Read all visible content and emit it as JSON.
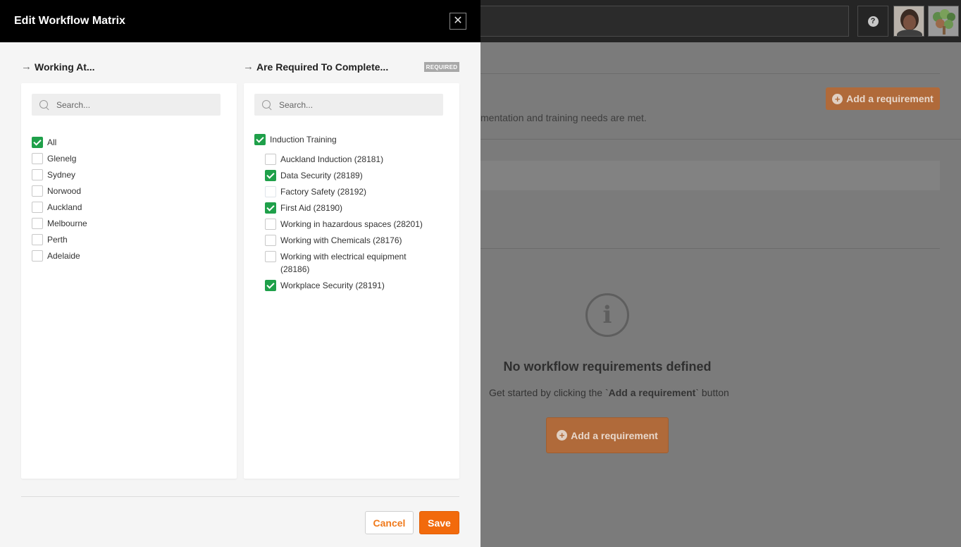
{
  "modal": {
    "title": "Edit Workflow Matrix",
    "close_symbol": "✕"
  },
  "working_at": {
    "heading": "Working At...",
    "search_placeholder": "Search...",
    "items": [
      {
        "label": "All",
        "checked": true
      },
      {
        "label": "Glenelg",
        "checked": false
      },
      {
        "label": "Sydney",
        "checked": false
      },
      {
        "label": "Norwood",
        "checked": false
      },
      {
        "label": "Auckland",
        "checked": false
      },
      {
        "label": "Melbourne",
        "checked": false
      },
      {
        "label": "Perth",
        "checked": false
      },
      {
        "label": "Adelaide",
        "checked": false
      }
    ]
  },
  "required_to_complete": {
    "heading": "Are Required To Complete...",
    "badge": "REQUIRED",
    "search_placeholder": "Search...",
    "group": {
      "label": "Induction Training",
      "checked": true
    },
    "items": [
      {
        "label": "Auckland Induction (28181)",
        "checked": false
      },
      {
        "label": "Data Security (28189)",
        "checked": true
      },
      {
        "label": "Factory Safety (28192)",
        "checked": false
      },
      {
        "label": "First Aid (28190)",
        "checked": true
      },
      {
        "label": "Working in hazardous spaces (28201)",
        "checked": false
      },
      {
        "label": "Working with Chemicals (28176)",
        "checked": false
      },
      {
        "label": "Working with electrical equipment",
        "label_line2": "(28186)",
        "checked": false
      },
      {
        "label": "Workplace Security (28191)",
        "checked": true
      }
    ]
  },
  "footer": {
    "cancel_label": "Cancel",
    "save_label": "Save"
  },
  "background": {
    "help_symbol": "?",
    "add_requirement_label": "Add a requirement",
    "partial_text": "mentation and training needs are met.",
    "info_symbol": "i",
    "empty_title": "No workflow requirements defined",
    "empty_sub_prefix": "Get started by clicking the `",
    "empty_sub_bold": "Add a requirement",
    "empty_sub_suffix": "` button",
    "add_requirement_main_label": "Add a requirement"
  },
  "colors": {
    "accent_orange": "#f26a0c",
    "check_green": "#1fa04a",
    "header_black": "#000000"
  }
}
